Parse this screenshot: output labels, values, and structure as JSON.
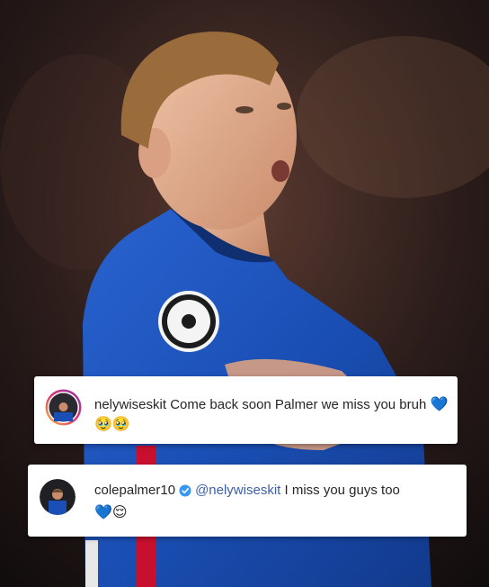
{
  "comments": [
    {
      "username": "nelywiseskit",
      "text": "Come back soon Palmer we miss you bruh",
      "emojis_line1": "💙",
      "emojis_line2": "🥹🥹"
    },
    {
      "username": "colepalmer10",
      "verified": true,
      "mention": "@nelywiseskit",
      "text": "I miss you guys too",
      "emojis_line2": "💙😌"
    }
  ],
  "colors": {
    "jersey_blue": "#1a4fb5",
    "mention_blue": "#3d5fa8",
    "verified_blue": "#3897f0",
    "card_bg": "#ffffff"
  }
}
